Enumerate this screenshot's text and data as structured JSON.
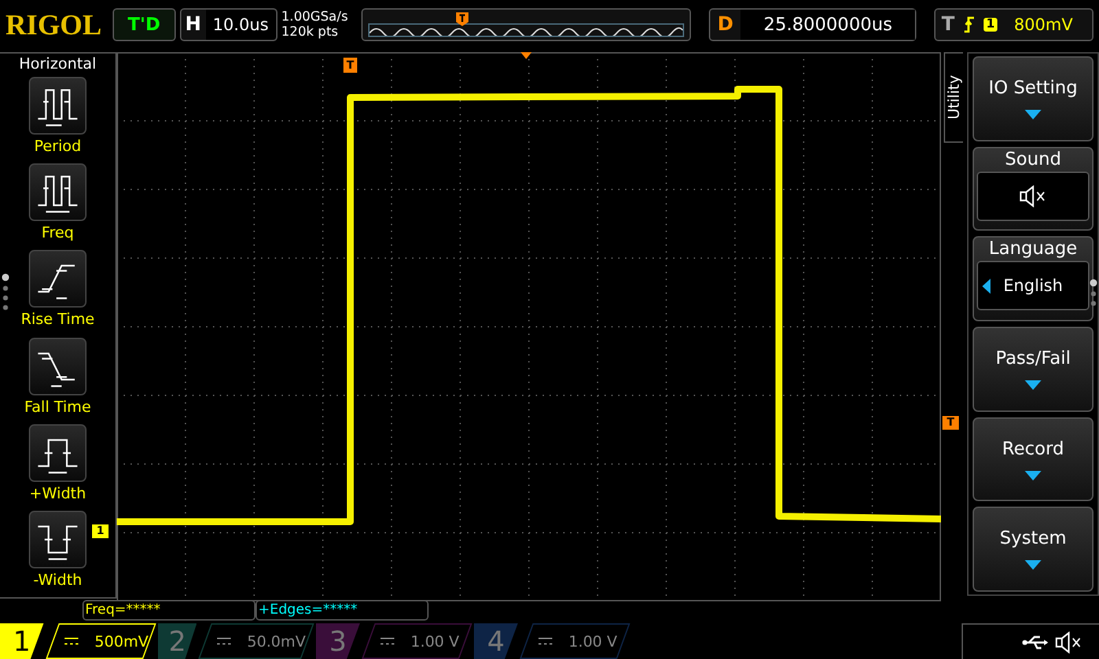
{
  "header": {
    "logo": "RIGOL",
    "trigger_status": "T'D",
    "timebase": {
      "label": "H",
      "value": "10.0us"
    },
    "sample_rate": "1.00GSa/s",
    "memory_depth": "120k pts",
    "delay": {
      "label": "D",
      "value": "25.8000000us"
    },
    "trigger": {
      "label": "T",
      "channel": "1",
      "level": "800mV"
    }
  },
  "left_menu": {
    "title": "Horizontal",
    "items": [
      {
        "label": "Period",
        "kind": "period"
      },
      {
        "label": "Freq",
        "kind": "freq"
      },
      {
        "label": "Rise Time",
        "kind": "rise"
      },
      {
        "label": "Fall Time",
        "kind": "fall"
      },
      {
        "label": "+Width",
        "kind": "pwidth"
      },
      {
        "label": "-Width",
        "kind": "nwidth"
      }
    ]
  },
  "plot": {
    "trigger_marker": "T",
    "channel_marker": "1",
    "level_marker": "T"
  },
  "right_menu": {
    "title": "Utility",
    "items": [
      {
        "kind": "submenu",
        "label": "IO Setting"
      },
      {
        "kind": "icon",
        "label": "Sound"
      },
      {
        "kind": "value",
        "label": "Language",
        "value": "English"
      },
      {
        "kind": "submenu",
        "label": "Pass/Fail"
      },
      {
        "kind": "submenu",
        "label": "Record"
      },
      {
        "kind": "submenu",
        "label": "System"
      }
    ]
  },
  "measurements": [
    {
      "text": "Freq=*****",
      "color": "#ffff00"
    },
    {
      "text": "+Edges=*****",
      "color": "#00ffff"
    }
  ],
  "channels": [
    {
      "number": "1",
      "scale": "500mV",
      "on": true,
      "color": "#ffff00"
    },
    {
      "number": "2",
      "scale": "50.0mV",
      "on": false,
      "color": "#0e3a34"
    },
    {
      "number": "3",
      "scale": "1.00 V",
      "on": false,
      "color": "#3a0e3a"
    },
    {
      "number": "4",
      "scale": "1.00 V",
      "on": false,
      "color": "#0e2446"
    }
  ]
}
